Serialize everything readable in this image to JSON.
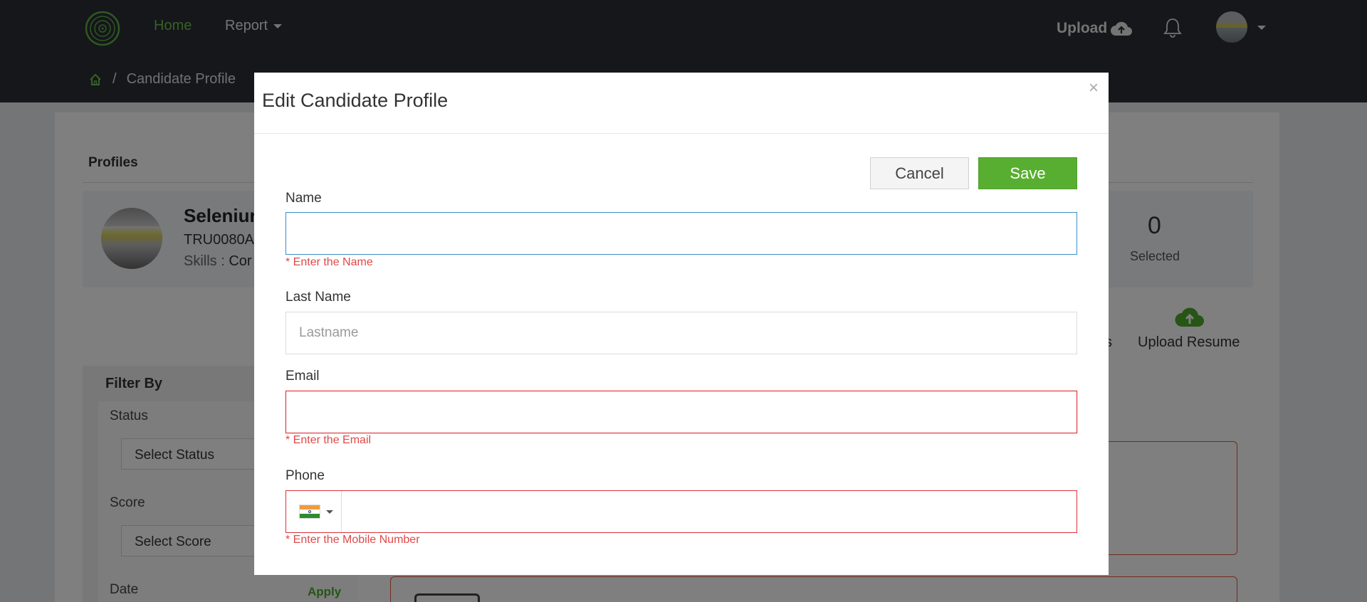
{
  "nav": {
    "home_label": "Home",
    "report_label": "Report",
    "upload_label": "Upload",
    "accent_color": "#6cc14f",
    "bg_color": "#2b2e35"
  },
  "breadcrumb": {
    "separator": "/",
    "current": "Candidate Profile"
  },
  "background": {
    "profiles_title": "Profiles",
    "candidate_name": "Seleniur",
    "candidate_id": "TRU0080A",
    "skills_label": "Skills : ",
    "skills_value": "Cor",
    "selected_count": "0",
    "selected_label": "Selected",
    "partial_action": "s",
    "upload_resume_label": "Upload Resume",
    "filter_title": "Filter By",
    "status_label": "Status",
    "status_select": "Select Status",
    "score_label": "Score",
    "score_select": "Select Score",
    "date_label": "Date",
    "apply_label": "Apply"
  },
  "modal": {
    "title": "Edit Candidate Profile",
    "close_glyph": "×",
    "cancel_label": "Cancel",
    "save_label": "Save",
    "save_color": "#58ae30",
    "error_color": "#e04848",
    "fields": {
      "name": {
        "label": "Name",
        "value": "",
        "error": "* Enter the Name"
      },
      "last_name": {
        "label": "Last Name",
        "value": "",
        "placeholder": "Lastname"
      },
      "email": {
        "label": "Email",
        "value": "",
        "error": "* Enter the Email"
      },
      "phone": {
        "label": "Phone",
        "value": "",
        "country": "India",
        "error": "* Enter the Mobile Number"
      }
    }
  }
}
